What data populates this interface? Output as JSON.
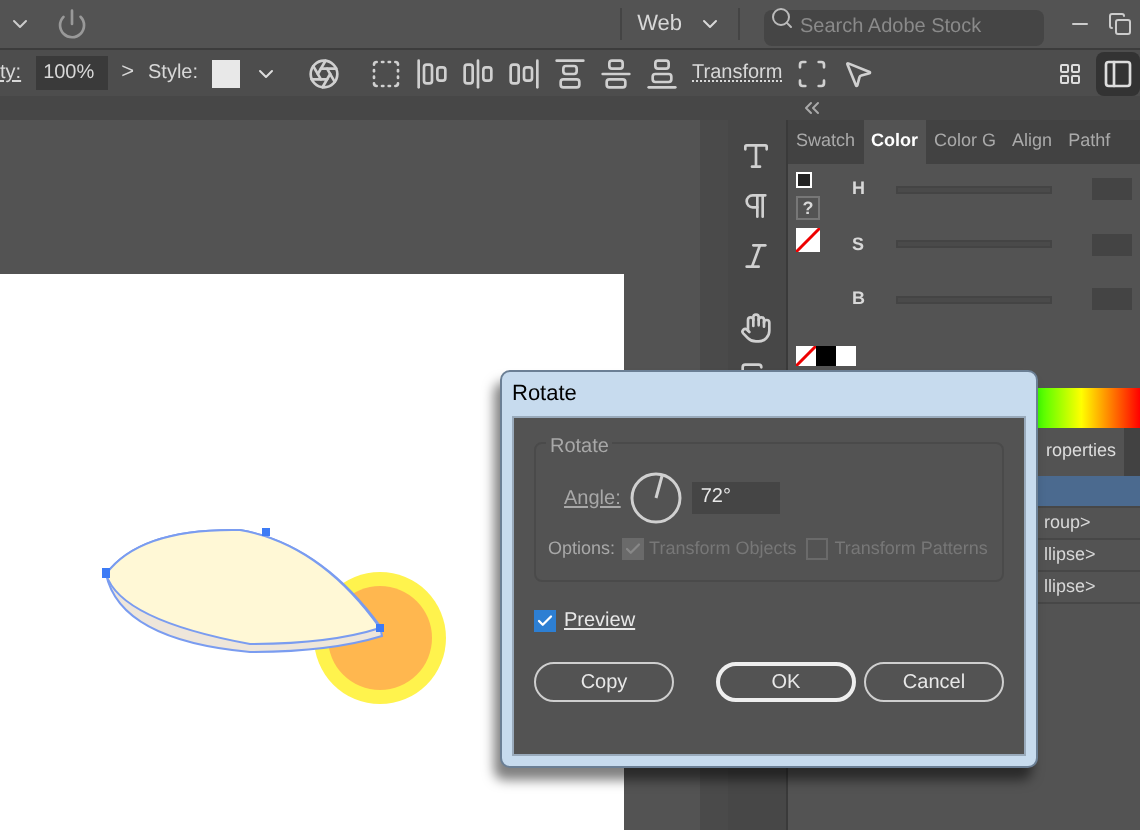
{
  "app_bar": {
    "workspace": "Web",
    "search": {
      "placeholder": "Search Adobe Stock"
    }
  },
  "control_bar": {
    "opacity_label": "ty:",
    "opacity": "100%",
    "more": ">",
    "style_label": "Style:",
    "transform": "Transform"
  },
  "color_panel": {
    "tabs": [
      {
        "label": "Swatch",
        "selected": false
      },
      {
        "label": "Color",
        "selected": true
      },
      {
        "label": "Color G",
        "selected": false
      },
      {
        "label": "Align",
        "selected": false
      },
      {
        "label": "Pathf",
        "selected": false
      }
    ],
    "unknown": "?",
    "channels": [
      {
        "name": "H"
      },
      {
        "name": "S"
      },
      {
        "name": "B"
      }
    ]
  },
  "layers_panel": {
    "tab": "roperties",
    "rows": [
      {
        "selected": true
      },
      {
        "label": "roup>",
        "selected": false
      },
      {
        "label": "llipse>",
        "selected": false
      },
      {
        "label": "llipse>",
        "selected": false
      }
    ]
  },
  "dialog": {
    "title": "Rotate",
    "group": "Rotate",
    "angle_label": "Angle:",
    "angle": "72°",
    "options_label": "Options:",
    "options": [
      {
        "label": "Transform Objects",
        "checked": true,
        "disabled": true
      },
      {
        "label": "Transform Patterns",
        "checked": false,
        "disabled": true
      }
    ],
    "preview": {
      "label": "Preview",
      "checked": true
    },
    "buttons": [
      {
        "label": "Copy",
        "default": false
      },
      {
        "label": "OK",
        "default": true
      },
      {
        "label": "Cancel",
        "default": false
      }
    ]
  }
}
